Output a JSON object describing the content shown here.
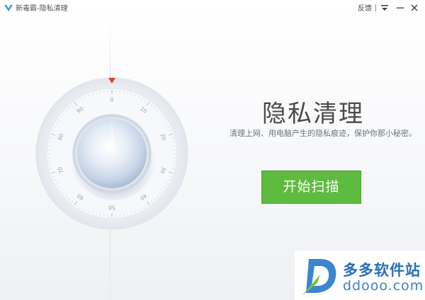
{
  "window": {
    "title": "新毒霸-隐私清理",
    "feedback_label": "反馈",
    "icons": {
      "logo": "duba-logo-icon",
      "menu": "menu-icon",
      "minimize": "minimize-icon",
      "close": "close-icon"
    }
  },
  "dial": {
    "ticks": [
      "0",
      "10",
      "20",
      "30",
      "40",
      "50",
      "60",
      "70",
      "80",
      "90"
    ],
    "pointer_icon": "pointer-triangle-icon",
    "knob_icon": "knob-icon"
  },
  "main": {
    "headline": "隐私清理",
    "subtitle": "清理上网、用电脑产生的隐私痕迹，保护你那小秘密。",
    "start_button_label": "开始扫描"
  },
  "watermark": {
    "cn": "多多软件站",
    "en": "ddooo.com"
  },
  "colors": {
    "accent_green": "#5dbb3f",
    "pointer_red": "#d2452c",
    "watermark_blue": "#2b6fb6"
  }
}
